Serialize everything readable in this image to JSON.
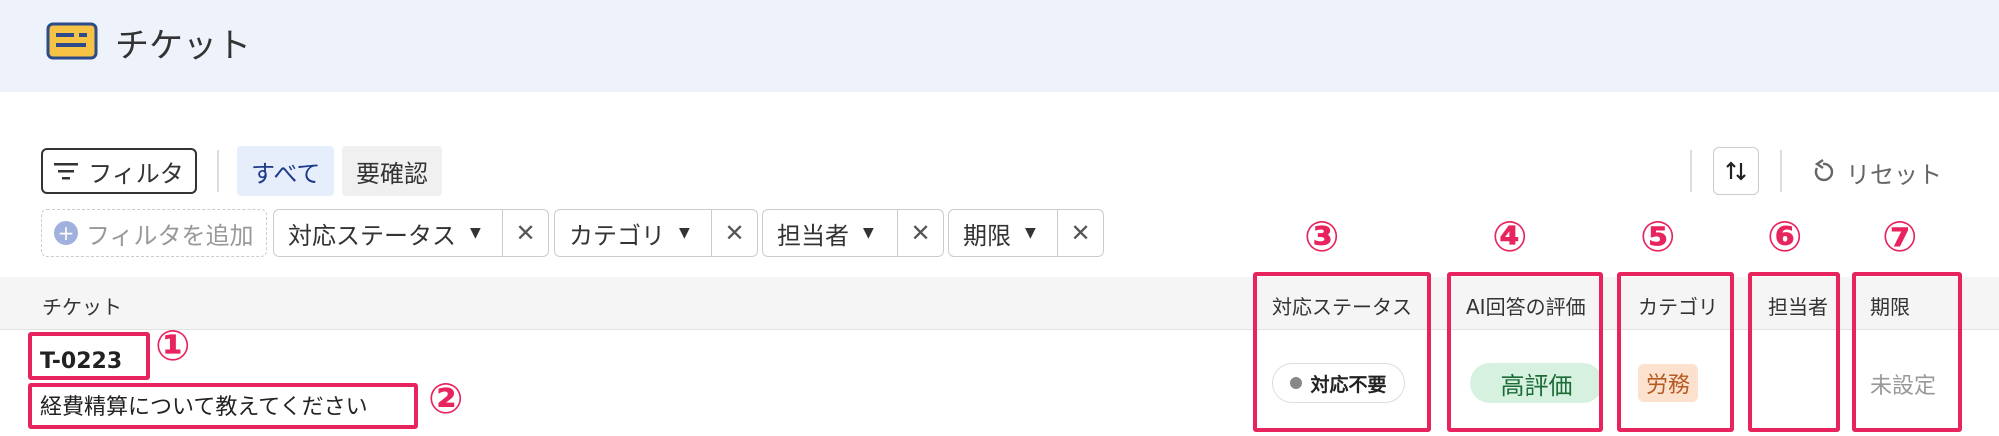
{
  "header": {
    "title": "チケット"
  },
  "toolbar": {
    "filter_label": "フィルタ",
    "views": [
      {
        "label": "すべて",
        "selected": true
      },
      {
        "label": "要確認",
        "selected": false
      }
    ],
    "reset_label": "リセット"
  },
  "filters": {
    "add_label": "フィルタを追加",
    "chips": [
      {
        "label": "対応ステータス"
      },
      {
        "label": "カテゴリ"
      },
      {
        "label": "担当者"
      },
      {
        "label": "期限"
      }
    ]
  },
  "table": {
    "columns": [
      {
        "label": "チケット"
      },
      {
        "label": "対応ステータス"
      },
      {
        "label": "AI回答の評価"
      },
      {
        "label": "カテゴリ"
      },
      {
        "label": "担当者"
      },
      {
        "label": "期限"
      }
    ],
    "rows": [
      {
        "id": "T-0223",
        "title": "経費精算について教えてください",
        "status": "対応不要",
        "ai_rating": "高評価",
        "category": "労務",
        "assignee": "",
        "deadline": "未設定"
      }
    ]
  },
  "annotations": [
    "①",
    "②",
    "③",
    "④",
    "⑤",
    "⑥",
    "⑦"
  ],
  "colors": {
    "accent": "#e8245f",
    "header_bg": "#eef3fb",
    "ai_badge_bg": "#d6f1df",
    "ai_badge_text": "#1d6b36",
    "category_badge_bg": "#fde1cf",
    "category_badge_text": "#b55a21"
  }
}
